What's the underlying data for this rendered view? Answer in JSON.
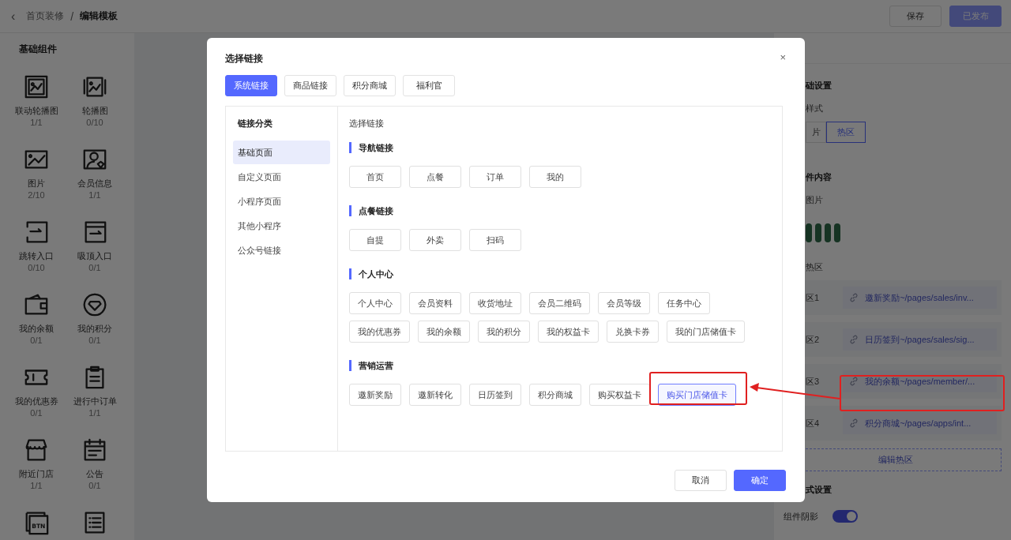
{
  "header": {
    "back": "‹",
    "breadcrumb": [
      {
        "label": "首页装修",
        "current": false
      },
      {
        "label": "编辑模板",
        "current": true
      }
    ],
    "separator": "/",
    "buttons": [
      {
        "label": "保存",
        "kind": "default",
        "disabled": false
      },
      {
        "label": "已发布",
        "kind": "primary",
        "disabled": true
      }
    ]
  },
  "sidebar": {
    "title": "基础组件",
    "items": [
      {
        "label": "联动轮播图",
        "count": "1/1"
      },
      {
        "label": "轮播图",
        "count": "0/10"
      },
      {
        "label": "图片",
        "count": "2/10"
      },
      {
        "label": "会员信息",
        "count": "1/1"
      },
      {
        "label": "跳转入口",
        "count": "0/10"
      },
      {
        "label": "吸顶入口",
        "count": "0/1"
      },
      {
        "label": "我的余额",
        "count": "0/1"
      },
      {
        "label": "我的积分",
        "count": "0/1"
      },
      {
        "label": "我的优惠券",
        "count": "0/1"
      },
      {
        "label": "进行中订单",
        "count": "1/1"
      },
      {
        "label": "附近门店",
        "count": "1/1"
      },
      {
        "label": "公告",
        "count": "0/1"
      }
    ],
    "icon_badge": "BTN"
  },
  "right_panel": {
    "section_title": "础设置",
    "style_label": "样式",
    "style_options": [
      {
        "label": "片",
        "selected": false
      },
      {
        "label": "热区",
        "selected": true
      }
    ],
    "content_title": "件内容",
    "image_label": "图片",
    "hotspot_label": "热区",
    "hotspots": [
      {
        "label": "区1",
        "link": "邀新奖励~/pages/sales/inv..."
      },
      {
        "label": "区2",
        "link": "日历签到~/pages/sales/sig..."
      },
      {
        "label": "区3",
        "link": "我的余额~/pages/member/..."
      },
      {
        "label": "区4",
        "link": "积分商城~/pages/apps/int..."
      }
    ],
    "edit_button": "编辑热区",
    "style_title": "式设置",
    "shadow": {
      "label": "组件阴影",
      "on": true
    }
  },
  "modal": {
    "title": "选择链接",
    "close": "×",
    "tabs": [
      {
        "label": "系统链接",
        "selected": true
      },
      {
        "label": "商品链接",
        "selected": false
      },
      {
        "label": "积分商城",
        "selected": false
      },
      {
        "label": "福利官",
        "selected": false
      }
    ],
    "categories_title": "链接分类",
    "categories": [
      {
        "label": "基础页面",
        "selected": true
      },
      {
        "label": "自定义页面",
        "selected": false
      },
      {
        "label": "小程序页面",
        "selected": false
      },
      {
        "label": "其他小程序",
        "selected": false
      },
      {
        "label": "公众号链接",
        "selected": false
      }
    ],
    "content_title": "选择链接",
    "groups": [
      {
        "title": "导航链接",
        "links": [
          {
            "label": "首页",
            "selected": false
          },
          {
            "label": "点餐",
            "selected": false
          },
          {
            "label": "订单",
            "selected": false
          },
          {
            "label": "我的",
            "selected": false
          }
        ]
      },
      {
        "title": "点餐链接",
        "links": [
          {
            "label": "自提",
            "selected": false
          },
          {
            "label": "外卖",
            "selected": false
          },
          {
            "label": "扫码",
            "selected": false
          }
        ]
      },
      {
        "title": "个人中心",
        "links": [
          {
            "label": "个人中心",
            "selected": false
          },
          {
            "label": "会员资料",
            "selected": false
          },
          {
            "label": "收货地址",
            "selected": false
          },
          {
            "label": "会员二维码",
            "selected": false
          },
          {
            "label": "会员等级",
            "selected": false
          },
          {
            "label": "任务中心",
            "selected": false
          },
          {
            "label": "我的优惠券",
            "selected": false
          },
          {
            "label": "我的余额",
            "selected": false
          },
          {
            "label": "我的积分",
            "selected": false
          },
          {
            "label": "我的权益卡",
            "selected": false
          },
          {
            "label": "兑换卡券",
            "selected": false
          },
          {
            "label": "我的门店储值卡",
            "selected": false
          }
        ]
      },
      {
        "title": "营销运营",
        "links": [
          {
            "label": "邀新奖励",
            "selected": false
          },
          {
            "label": "邀新转化",
            "selected": false
          },
          {
            "label": "日历签到",
            "selected": false
          },
          {
            "label": "积分商城",
            "selected": false
          },
          {
            "label": "购买权益卡",
            "selected": false
          },
          {
            "label": "购买门店储值卡",
            "selected": true
          }
        ]
      }
    ],
    "buttons": [
      {
        "label": "取消",
        "kind": "default"
      },
      {
        "label": "确定",
        "kind": "primary"
      }
    ]
  }
}
